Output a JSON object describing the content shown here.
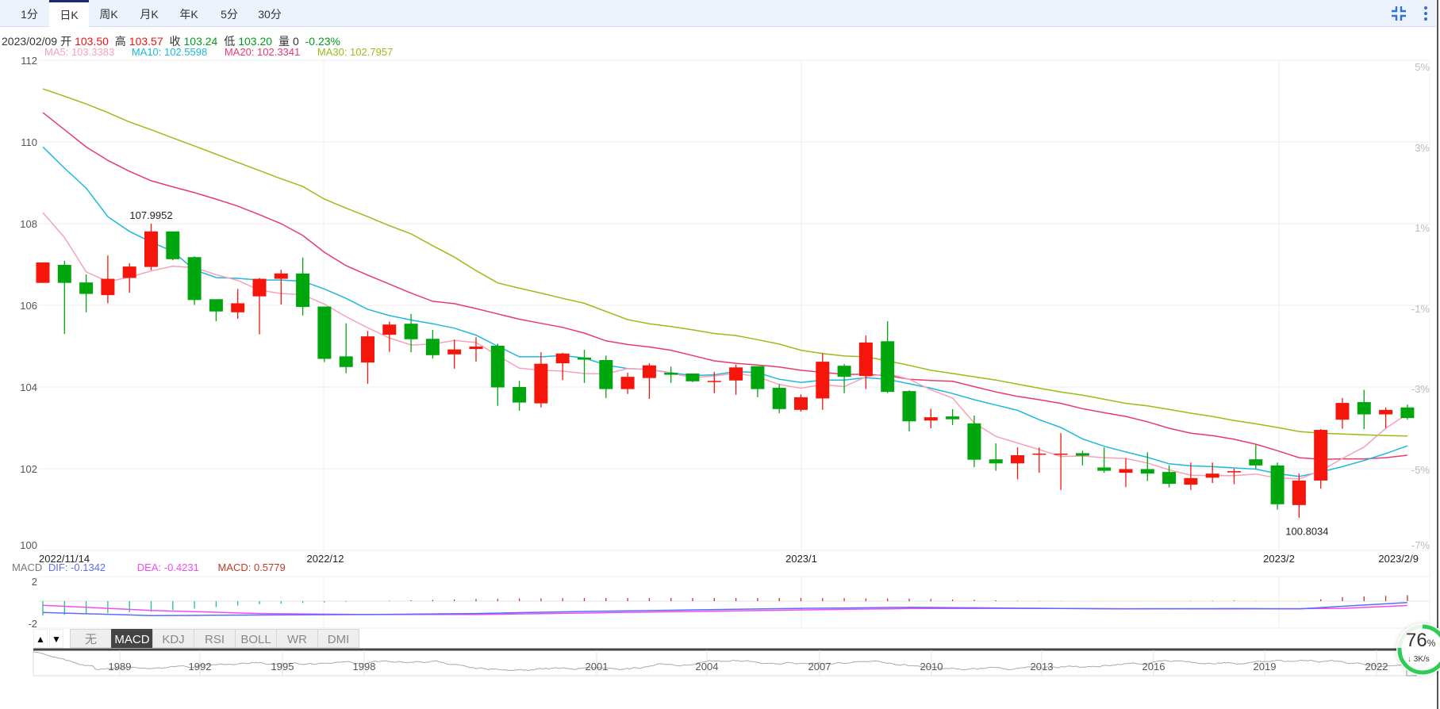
{
  "tabs": [
    {
      "label": "1分",
      "active": false
    },
    {
      "label": "日K",
      "active": true
    },
    {
      "label": "周K",
      "active": false
    },
    {
      "label": "月K",
      "active": false
    },
    {
      "label": "年K",
      "active": false
    },
    {
      "label": "5分",
      "active": false
    },
    {
      "label": "30分",
      "active": false
    }
  ],
  "toolbar": {
    "icons": [
      "exit-fullscreen-icon",
      "more-vertical-icon"
    ],
    "accent": "#2f6fd6"
  },
  "info": {
    "date": "2023/02/09",
    "open_label": "开",
    "open": "103.50",
    "high_label": "高",
    "high": "103.57",
    "close_label": "收",
    "close": "103.24",
    "low_label": "低",
    "low": "103.20",
    "volume_label": "量",
    "volume": "0",
    "change": "-0.23%"
  },
  "ma_legend": {
    "ma5": "MA5: 103.3383",
    "ma10": "MA10: 102.5598",
    "ma20": "MA20: 102.3341",
    "ma30": "MA30: 102.7957"
  },
  "colors": {
    "up": "#f5150b",
    "down": "#00a60e",
    "ma5": "#f7a1b9",
    "ma10": "#1cb9dc",
    "ma20": "#e83a6f",
    "ma30": "#97be16",
    "dif": "#5b6cff",
    "dea": "#f04cf0",
    "macd": "#c0392b"
  },
  "chart_data": [
    {
      "type": "candlestick",
      "ylim": [
        100,
        112
      ],
      "y_ticks": [
        "112",
        "110",
        "108",
        "106",
        "104",
        "102",
        "100"
      ],
      "y_tick_values": [
        112,
        110,
        108,
        106,
        104,
        102,
        100
      ],
      "pct_ticks": [
        "5%",
        "3%",
        "1%",
        "-1%",
        "-3%",
        "-5%",
        "-7%"
      ],
      "x_labels": [
        {
          "label": "2022/11/14",
          "index": 0
        },
        {
          "label": "2022/12",
          "index": 13
        },
        {
          "label": "2023/1",
          "index": 35
        },
        {
          "label": "2023/2",
          "index": 57
        },
        {
          "label": "2023/2/9",
          "index": 63
        }
      ],
      "annotations": [
        {
          "label": "107.9952",
          "index": 5,
          "value": 107.9952,
          "kind": "high"
        },
        {
          "label": "100.8034",
          "index": 58,
          "value": 100.8034,
          "kind": "low"
        }
      ],
      "ohlc_order": [
        "open",
        "high",
        "low",
        "close"
      ],
      "candles": [
        [
          106.55,
          107.05,
          106.55,
          107.05
        ],
        [
          106.99,
          107.09,
          105.3,
          106.55
        ],
        [
          106.56,
          106.76,
          105.83,
          106.28
        ],
        [
          106.25,
          107.22,
          106.05,
          106.65
        ],
        [
          106.67,
          107.03,
          106.31,
          106.95
        ],
        [
          106.94,
          108.0,
          106.86,
          107.81
        ],
        [
          107.81,
          107.81,
          107.1,
          107.13
        ],
        [
          107.18,
          107.2,
          106.01,
          106.13
        ],
        [
          106.15,
          106.15,
          105.61,
          105.85
        ],
        [
          105.83,
          106.4,
          105.67,
          106.05
        ],
        [
          106.22,
          106.67,
          105.29,
          106.65
        ],
        [
          106.65,
          106.87,
          106.02,
          106.78
        ],
        [
          106.78,
          107.17,
          105.75,
          105.96
        ],
        [
          105.97,
          105.97,
          104.61,
          104.69
        ],
        [
          104.75,
          105.56,
          104.34,
          104.49
        ],
        [
          104.6,
          105.37,
          104.08,
          105.24
        ],
        [
          105.28,
          105.6,
          104.86,
          105.53
        ],
        [
          105.55,
          105.79,
          104.85,
          105.17
        ],
        [
          105.18,
          105.4,
          104.7,
          104.78
        ],
        [
          104.8,
          105.16,
          104.45,
          104.92
        ],
        [
          104.93,
          105.22,
          104.62,
          104.99
        ],
        [
          105.01,
          105.06,
          103.54,
          103.99
        ],
        [
          104.0,
          104.15,
          103.42,
          103.62
        ],
        [
          103.6,
          104.85,
          103.5,
          104.57
        ],
        [
          104.58,
          104.84,
          104.17,
          104.82
        ],
        [
          104.72,
          104.91,
          104.1,
          104.67
        ],
        [
          104.66,
          104.77,
          103.73,
          103.95
        ],
        [
          103.95,
          104.35,
          103.83,
          104.25
        ],
        [
          104.22,
          104.58,
          103.71,
          104.53
        ],
        [
          104.35,
          104.5,
          104.1,
          104.3
        ],
        [
          104.33,
          104.33,
          104.12,
          104.14
        ],
        [
          104.13,
          104.37,
          103.85,
          104.15
        ],
        [
          104.16,
          104.55,
          103.81,
          104.48
        ],
        [
          104.51,
          104.51,
          103.75,
          103.95
        ],
        [
          103.98,
          104.07,
          103.36,
          103.46
        ],
        [
          103.44,
          103.82,
          103.4,
          103.75
        ],
        [
          103.72,
          104.83,
          103.44,
          104.62
        ],
        [
          104.52,
          104.56,
          103.85,
          104.25
        ],
        [
          104.27,
          105.26,
          103.95,
          105.09
        ],
        [
          105.12,
          105.61,
          103.85,
          103.88
        ],
        [
          103.9,
          103.92,
          102.91,
          103.16
        ],
        [
          103.18,
          103.47,
          102.99,
          103.26
        ],
        [
          103.28,
          103.46,
          103.07,
          103.21
        ],
        [
          103.11,
          103.3,
          102.04,
          102.22
        ],
        [
          102.23,
          102.62,
          101.95,
          102.13
        ],
        [
          102.13,
          102.52,
          101.74,
          102.33
        ],
        [
          102.35,
          102.52,
          101.9,
          102.37
        ],
        [
          102.35,
          102.87,
          101.48,
          102.37
        ],
        [
          102.38,
          102.44,
          102.08,
          102.32
        ],
        [
          102.03,
          102.52,
          101.9,
          101.95
        ],
        [
          101.9,
          102.25,
          101.55,
          101.99
        ],
        [
          101.99,
          102.4,
          101.7,
          101.88
        ],
        [
          101.92,
          102.08,
          101.54,
          101.63
        ],
        [
          101.61,
          102.15,
          101.48,
          101.77
        ],
        [
          101.78,
          102.15,
          101.65,
          101.88
        ],
        [
          101.91,
          102.0,
          101.62,
          101.94
        ],
        [
          102.23,
          102.58,
          102.0,
          102.08
        ],
        [
          102.08,
          102.15,
          101.0,
          101.13
        ],
        [
          101.11,
          101.88,
          100.8,
          101.71
        ],
        [
          101.71,
          102.97,
          101.51,
          102.95
        ],
        [
          103.2,
          103.73,
          102.98,
          103.61
        ],
        [
          103.63,
          103.93,
          102.97,
          103.33
        ],
        [
          103.33,
          103.5,
          103.0,
          103.44
        ],
        [
          103.5,
          103.57,
          103.2,
          103.24
        ]
      ],
      "ma": {
        "ma5": [
          108.27,
          107.66,
          106.82,
          106.58,
          106.69,
          106.84,
          106.96,
          106.92,
          106.75,
          106.61,
          106.37,
          106.29,
          106.26,
          106.03,
          105.72,
          105.45,
          105.2,
          105.03,
          105.05,
          105.14,
          105.09,
          104.77,
          104.46,
          104.41,
          104.39,
          104.33,
          104.32,
          104.45,
          104.43,
          104.34,
          104.23,
          104.27,
          104.34,
          104.25,
          104.06,
          103.97,
          104.06,
          104.01,
          104.25,
          104.33,
          104.19,
          103.93,
          103.73,
          103.12,
          102.79,
          102.63,
          102.47,
          102.3,
          102.31,
          102.27,
          102.25,
          102.14,
          101.97,
          101.84,
          101.83,
          101.83,
          101.87,
          101.77,
          101.75,
          101.95,
          102.25,
          102.53,
          102.99,
          103.34
        ],
        "ma10": [
          109.88,
          109.36,
          108.87,
          108.17,
          107.81,
          107.55,
          107.32,
          106.87,
          106.68,
          106.66,
          106.62,
          106.62,
          106.59,
          106.4,
          106.17,
          105.9,
          105.75,
          105.64,
          105.55,
          105.44,
          105.27,
          105.0,
          104.74,
          104.74,
          104.77,
          104.71,
          104.54,
          104.45,
          104.43,
          104.35,
          104.28,
          104.3,
          104.38,
          104.35,
          104.19,
          104.11,
          104.17,
          104.17,
          104.23,
          104.19,
          104.08,
          103.97,
          103.84,
          103.69,
          103.56,
          103.43,
          103.2,
          103.01,
          102.73,
          102.55,
          102.41,
          102.28,
          102.12,
          102.07,
          102.05,
          102.02,
          101.99,
          101.88,
          101.81,
          101.92,
          102.05,
          102.2,
          102.37,
          102.56
        ],
        "ma20": [
          110.72,
          110.3,
          109.88,
          109.55,
          109.28,
          109.05,
          108.9,
          108.76,
          108.6,
          108.43,
          108.22,
          108.0,
          107.71,
          107.3,
          106.97,
          106.74,
          106.52,
          106.3,
          106.1,
          106.04,
          105.92,
          105.79,
          105.66,
          105.56,
          105.46,
          105.32,
          105.13,
          105.04,
          104.98,
          104.9,
          104.77,
          104.64,
          104.58,
          104.54,
          104.49,
          104.41,
          104.36,
          104.31,
          104.31,
          104.28,
          104.19,
          104.16,
          104.14,
          104.01,
          103.88,
          103.77,
          103.69,
          103.6,
          103.47,
          103.37,
          103.28,
          103.15,
          102.99,
          102.87,
          102.81,
          102.72,
          102.6,
          102.44,
          102.27,
          102.23,
          102.24,
          102.24,
          102.27,
          102.33
        ],
        "ma30": [
          111.3,
          111.12,
          110.93,
          110.72,
          110.49,
          110.3,
          110.1,
          109.9,
          109.7,
          109.5,
          109.3,
          109.1,
          108.91,
          108.6,
          108.38,
          108.17,
          107.95,
          107.75,
          107.46,
          107.18,
          106.85,
          106.55,
          106.42,
          106.3,
          106.17,
          106.05,
          105.85,
          105.65,
          105.55,
          105.48,
          105.4,
          105.31,
          105.26,
          105.16,
          105.05,
          104.9,
          104.82,
          104.76,
          104.74,
          104.64,
          104.53,
          104.41,
          104.33,
          104.25,
          104.17,
          104.07,
          103.97,
          103.88,
          103.8,
          103.7,
          103.6,
          103.54,
          103.45,
          103.36,
          103.28,
          103.18,
          103.1,
          103.01,
          102.91,
          102.87,
          102.85,
          102.83,
          102.81,
          102.8
        ]
      }
    },
    {
      "type": "macd",
      "y_ticks": [
        "2",
        "-2"
      ],
      "legend": {
        "title": "MACD",
        "dif": "DIF: -0.1342",
        "dea": "DEA: -0.4231",
        "macd": "MACD: 0.5779"
      },
      "dif_points": [
        [
          0,
          -1.1
        ],
        [
          5,
          -1.4
        ],
        [
          10,
          -1.35
        ],
        [
          15,
          -1.3
        ],
        [
          20,
          -1.2
        ],
        [
          25,
          -1.0
        ],
        [
          30,
          -0.85
        ],
        [
          35,
          -0.7
        ],
        [
          40,
          -0.6
        ],
        [
          45,
          -0.68
        ],
        [
          50,
          -0.75
        ],
        [
          55,
          -0.72
        ],
        [
          58,
          -0.75
        ],
        [
          60,
          -0.5
        ],
        [
          63,
          -0.1342
        ]
      ],
      "dea_points": [
        [
          0,
          -0.4
        ],
        [
          5,
          -0.9
        ],
        [
          10,
          -1.2
        ],
        [
          15,
          -1.3
        ],
        [
          20,
          -1.3
        ],
        [
          25,
          -1.15
        ],
        [
          30,
          -1.0
        ],
        [
          35,
          -0.85
        ],
        [
          40,
          -0.72
        ],
        [
          45,
          -0.7
        ],
        [
          50,
          -0.74
        ],
        [
          55,
          -0.75
        ],
        [
          58,
          -0.73
        ],
        [
          60,
          -0.7
        ],
        [
          63,
          -0.4231
        ]
      ]
    }
  ],
  "indicators": {
    "up_label": "▲",
    "down_label": "▼",
    "buttons": [
      {
        "label": "无",
        "active": false
      },
      {
        "label": "MACD",
        "active": true
      },
      {
        "label": "KDJ",
        "active": false
      },
      {
        "label": "RSI",
        "active": false
      },
      {
        "label": "BOLL",
        "active": false
      },
      {
        "label": "WR",
        "active": false
      },
      {
        "label": "DMI",
        "active": false
      }
    ]
  },
  "navigator": {
    "years": [
      "1989",
      "1992",
      "1995",
      "1998",
      "2001",
      "2004",
      "2007",
      "2010",
      "2013",
      "2016",
      "2019",
      "2022"
    ]
  },
  "progress": {
    "percent": 76,
    "percent_text": "76",
    "unit": "%",
    "speed": "3K/s",
    "arrow": "↓"
  }
}
